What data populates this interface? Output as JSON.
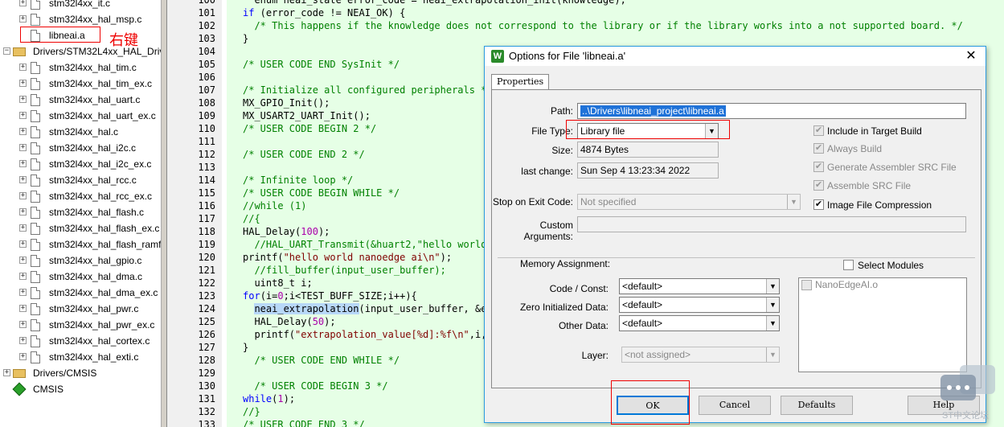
{
  "tree": {
    "items": [
      {
        "label": "stm32l4xx_it.c",
        "kind": "file",
        "expand": "+"
      },
      {
        "label": "stm32l4xx_hal_msp.c",
        "kind": "file",
        "expand": "+"
      },
      {
        "label": "libneai.a",
        "kind": "file",
        "expand": ""
      },
      {
        "label": "Drivers/STM32L4xx_HAL_Driver",
        "kind": "folder",
        "expand": "−"
      },
      {
        "label": "stm32l4xx_hal_tim.c",
        "kind": "file",
        "expand": "+"
      },
      {
        "label": "stm32l4xx_hal_tim_ex.c",
        "kind": "file",
        "expand": "+"
      },
      {
        "label": "stm32l4xx_hal_uart.c",
        "kind": "file",
        "expand": "+"
      },
      {
        "label": "stm32l4xx_hal_uart_ex.c",
        "kind": "file",
        "expand": "+"
      },
      {
        "label": "stm32l4xx_hal.c",
        "kind": "file",
        "expand": "+"
      },
      {
        "label": "stm32l4xx_hal_i2c.c",
        "kind": "file",
        "expand": "+"
      },
      {
        "label": "stm32l4xx_hal_i2c_ex.c",
        "kind": "file",
        "expand": "+"
      },
      {
        "label": "stm32l4xx_hal_rcc.c",
        "kind": "file",
        "expand": "+"
      },
      {
        "label": "stm32l4xx_hal_rcc_ex.c",
        "kind": "file",
        "expand": "+"
      },
      {
        "label": "stm32l4xx_hal_flash.c",
        "kind": "file",
        "expand": "+"
      },
      {
        "label": "stm32l4xx_hal_flash_ex.c",
        "kind": "file",
        "expand": "+"
      },
      {
        "label": "stm32l4xx_hal_flash_ramfunc.c",
        "kind": "file",
        "expand": "+"
      },
      {
        "label": "stm32l4xx_hal_gpio.c",
        "kind": "file",
        "expand": "+"
      },
      {
        "label": "stm32l4xx_hal_dma.c",
        "kind": "file",
        "expand": "+"
      },
      {
        "label": "stm32l4xx_hal_dma_ex.c",
        "kind": "file",
        "expand": "+"
      },
      {
        "label": "stm32l4xx_hal_pwr.c",
        "kind": "file",
        "expand": "+"
      },
      {
        "label": "stm32l4xx_hal_pwr_ex.c",
        "kind": "file",
        "expand": "+"
      },
      {
        "label": "stm32l4xx_hal_cortex.c",
        "kind": "file",
        "expand": "+"
      },
      {
        "label": "stm32l4xx_hal_exti.c",
        "kind": "file",
        "expand": "+"
      },
      {
        "label": "Drivers/CMSIS",
        "kind": "folder",
        "expand": "+"
      },
      {
        "label": "CMSIS",
        "kind": "component",
        "expand": ""
      }
    ],
    "annotation": "右键"
  },
  "editor": {
    "line_numbers": [
      "100",
      "101",
      "102",
      "103",
      "104",
      "105",
      "106",
      "107",
      "108",
      "109",
      "110",
      "111",
      "112",
      "113",
      "114",
      "115",
      "116",
      "117",
      "118",
      "119",
      "120",
      "121",
      "122",
      "123",
      "124",
      "125",
      "126",
      "127",
      "128",
      "129",
      "130",
      "131",
      "132",
      "133"
    ]
  },
  "dialog": {
    "title": "Options for File 'libneai.a'",
    "close_glyph": "✕",
    "icon_glyph": "W",
    "tab": "Properties",
    "path_label": "Path:",
    "path_value": "..\\Drivers\\libneai_project\\libneai.a",
    "filetype_label": "File Type:",
    "filetype_value": "Library file",
    "size_label": "Size:",
    "size_value": "4874 Bytes",
    "lastchange_label": "last change:",
    "lastchange_value": "Sun Sep  4 13:23:34 2022",
    "stop_label": "Stop on Exit Code:",
    "stop_value": "Not specified",
    "custom_label": "Custom Arguments:",
    "custom_value": "",
    "include_label": "Include in Target Build",
    "always_label": "Always Build",
    "gen_asm_label": "Generate Assembler SRC File",
    "asm_src_label": "Assemble SRC File",
    "img_comp_label": "Image File Compression",
    "mem_label": "Memory Assignment:",
    "select_modules_label": "Select Modules",
    "code_const_label": "Code / Const:",
    "code_const_value": "<default>",
    "zero_init_label": "Zero Initialized Data:",
    "zero_init_value": "<default>",
    "other_data_label": "Other Data:",
    "other_data_value": "<default>",
    "layer_label": "Layer:",
    "layer_value": "<not assigned>",
    "module_item": "NanoEdgeAI.o",
    "ok_label": "OK",
    "cancel_label": "Cancel",
    "defaults_label": "Defaults",
    "help_label": "Help"
  },
  "watermark": "ST中文论坛",
  "colors": {
    "accent": "#0078d7",
    "annotation": "#ee0000",
    "editor_bg": "#e6ffe6",
    "selection": "#1f72d8"
  }
}
